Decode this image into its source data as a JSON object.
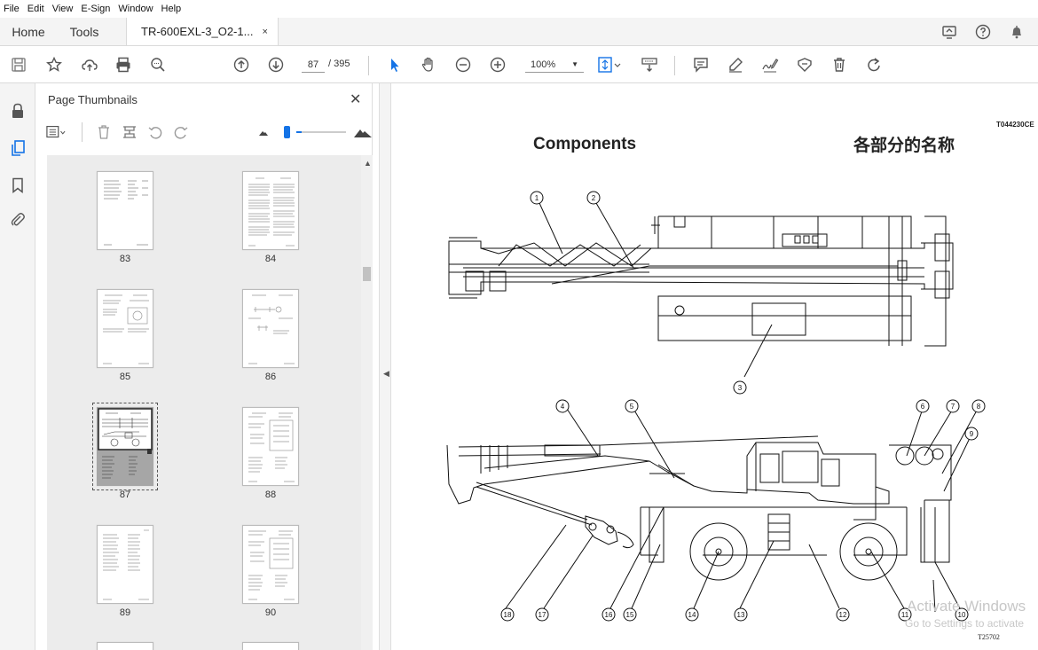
{
  "menu": [
    "File",
    "Edit",
    "View",
    "E-Sign",
    "Window",
    "Help"
  ],
  "tabs": {
    "home": "Home",
    "tools": "Tools",
    "document": "TR-600EXL-3_O2-1...",
    "close_glyph": "×"
  },
  "toolbar": {
    "page_current": "87",
    "page_total": "/ 395",
    "zoom": "100%"
  },
  "panel": {
    "title": "Page Thumbnails",
    "close": "✕",
    "thumbnails": [
      {
        "label": "83"
      },
      {
        "label": "84"
      },
      {
        "label": "85"
      },
      {
        "label": "86"
      },
      {
        "label": "87"
      },
      {
        "label": "88"
      },
      {
        "label": "89"
      },
      {
        "label": "90"
      }
    ],
    "selected_page": "87",
    "thumb_size_level": 0.1
  },
  "document": {
    "code": "T044230CE",
    "title": "Components",
    "title_cn": "各部分的名称",
    "figure_code": "T25702",
    "callouts": [
      "1",
      "2",
      "3",
      "4",
      "5",
      "6",
      "7",
      "8",
      "9",
      "10",
      "11",
      "12",
      "13",
      "14",
      "15",
      "16",
      "17",
      "18"
    ]
  },
  "watermark": {
    "line1": "Activate Windows",
    "line2": "Go to Settings to activate"
  },
  "colors": {
    "accent": "#1473e6",
    "selection_fill": "#a6a6a6"
  }
}
